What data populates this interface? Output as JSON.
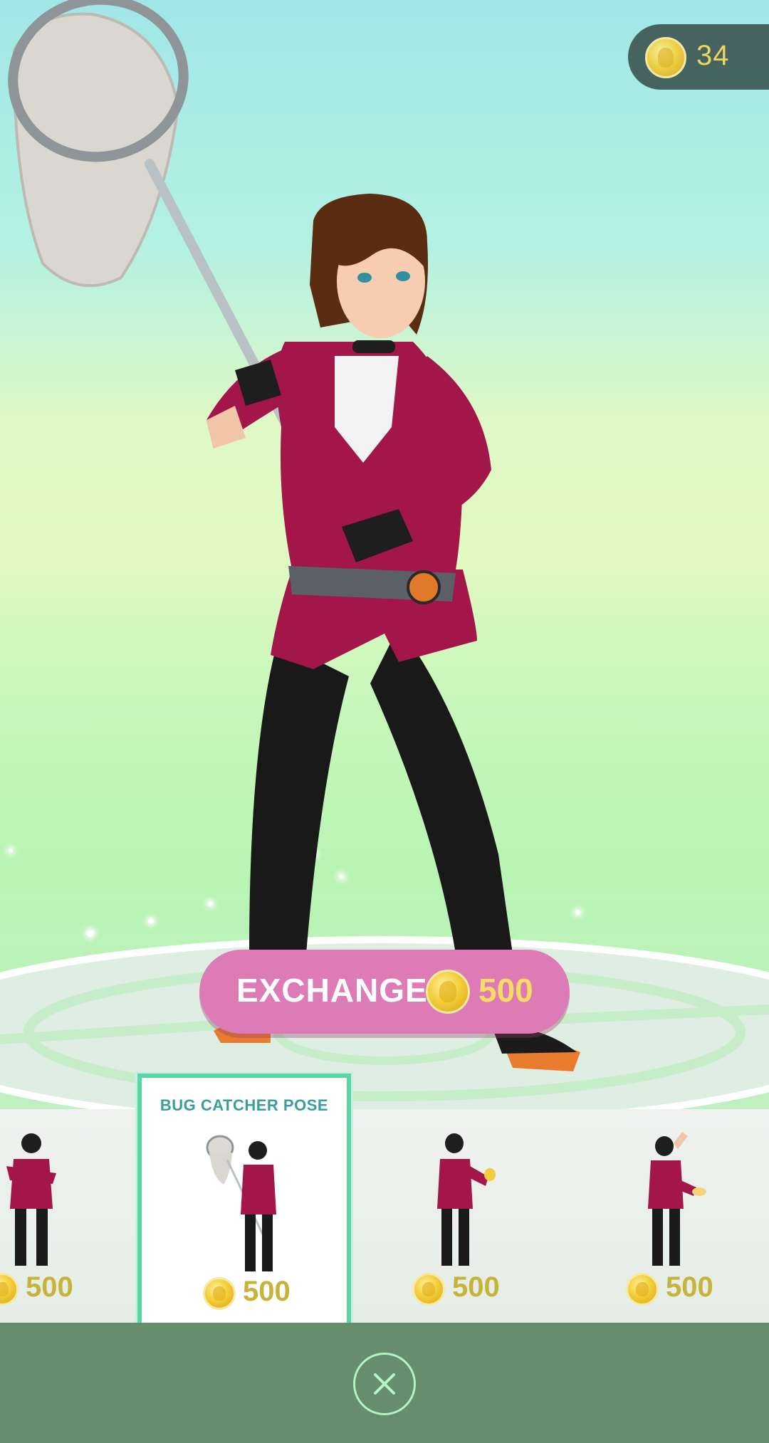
{
  "balance": {
    "coin_icon": "pokecoin-icon",
    "amount": "34"
  },
  "exchange": {
    "label": "EXCHANGE",
    "coin_icon": "pokecoin-icon",
    "price": "500",
    "color": "#dd7bb7"
  },
  "items": [
    {
      "title": "",
      "price": "500",
      "selected": false
    },
    {
      "title": "BUG CATCHER POSE",
      "price": "500",
      "selected": true
    },
    {
      "title": "",
      "price": "500",
      "selected": false
    },
    {
      "title": "",
      "price": "500",
      "selected": false
    }
  ],
  "close": {
    "icon": "close-icon"
  },
  "colors": {
    "accent": "#58d6a6",
    "bottom_bar": "#668d6e",
    "coin": "#f2cf3a"
  }
}
